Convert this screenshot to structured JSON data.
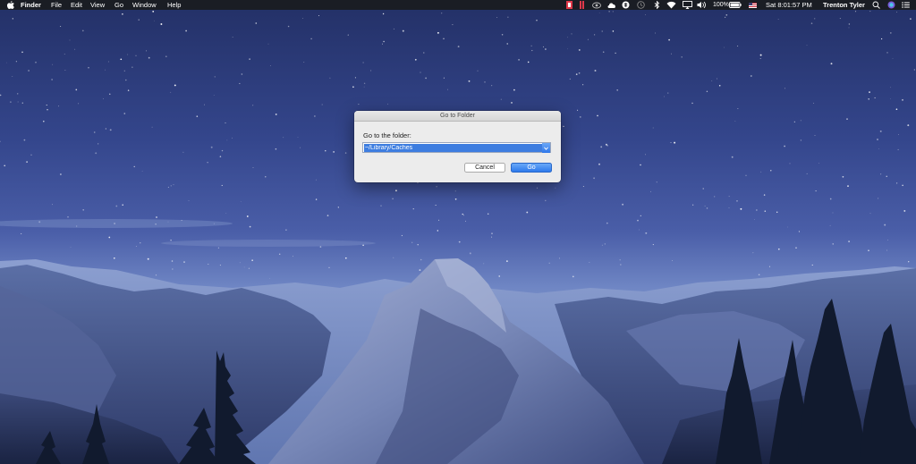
{
  "menubar": {
    "apple_icon": "apple-icon",
    "app_name": "Finder",
    "menus": [
      "File",
      "Edit",
      "View",
      "Go",
      "Window",
      "Help"
    ],
    "status_icons": [
      "record-icon",
      "pause-icon",
      "eye-icon",
      "cloud-icon",
      "dropbox-icon",
      "clock-icon",
      "bluetooth-icon",
      "wifi-icon",
      "airplay-icon",
      "volume-icon"
    ],
    "battery_percent": "100%",
    "flag_icon": "us-flag-icon",
    "clock": "Sat 8:01:57 PM",
    "user": "Trenton Tyler",
    "right_icons": [
      "spotlight-icon",
      "siri-icon",
      "notification-center-icon"
    ]
  },
  "dialog": {
    "title": "Go to Folder",
    "label": "Go to the folder:",
    "path_value": "~/Library/Caches",
    "cancel_label": "Cancel",
    "go_label": "Go",
    "accent": "#2f78ea"
  }
}
